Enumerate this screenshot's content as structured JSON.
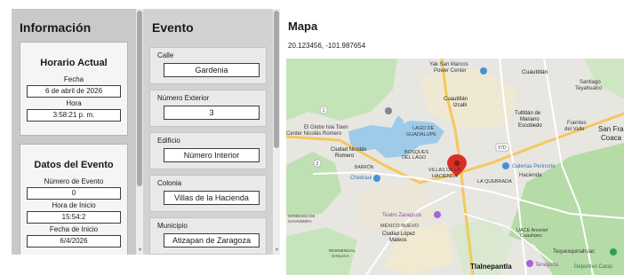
{
  "info": {
    "title": "Información",
    "horario": {
      "heading": "Horario Actual",
      "fecha_label": "Fecha",
      "fecha": "6 de abril de 2026",
      "hora_label": "Hora",
      "hora": "3:58:21 p. m."
    },
    "datos": {
      "heading": "Datos del Evento",
      "numero_label": "Número de Evento",
      "numero": "0",
      "hora_inicio_label": "Hora de Inicio",
      "hora_inicio": "15:54:2",
      "fecha_inicio_label": "Fecha de Inicio",
      "fecha_inicio": "6/4/2026"
    }
  },
  "evento": {
    "title": "Evento",
    "fields": [
      {
        "label": "Calle",
        "value": "Gardenia"
      },
      {
        "label": "Número Exterior",
        "value": "3"
      },
      {
        "label": "Edificio",
        "value": "Número Interior"
      },
      {
        "label": "Colonia",
        "value": "Villas de la Hacienda"
      },
      {
        "label": "Municipio",
        "value": "Atizapan de Zaragoza"
      }
    ]
  },
  "mapa": {
    "title": "Mapa",
    "coords": "20.123456, -101.987654",
    "places": {
      "yak_san_marcos": "Yak San Marcos",
      "power_center": "Power Center",
      "cuautitlan": "Cuautitlán",
      "santiago": "Santiago",
      "teyahualco": "Teyahualco",
      "cuautitlan_izcalli_1": "Cuautitlán",
      "cuautitlan_izcalli_2": "Izcalli",
      "tultitlan_1": "Tultitlán de",
      "tultitlan_2": "Mariano",
      "tultitlan_3": "Escobedo",
      "fuentes_1": "Fuentes",
      "fuentes_2": "del Valle",
      "san_fran_1": "San Fran",
      "san_fran_2": "Coaca",
      "globo_1": "El Globo Isla Town",
      "globo_2": "Center Nicolás Romero",
      "lago_1": "LAGO DE",
      "lago_2": "GUADALUPE",
      "ciudad_nicolas_1": "Ciudad Nicolás",
      "ciudad_nicolas_2": "Romero",
      "bosques_1": "BOSQUES",
      "bosques_2": "DEL LAGO",
      "galerias": "Galerías Perinorte",
      "barron": "BARRÓN",
      "chedraui": "Chedraui",
      "villas_1": "VILLAS DE LA",
      "villas_2": "HACIENDA",
      "hacienda": "Hacienda",
      "la_quebrada": "LA QUEBRADA",
      "teatro": "Teatro Zaragoza",
      "condado_1": "CONDADO DE",
      "condado_2": "SAYAVEDRA",
      "mexico_nuevo": "MÉXICO NUEVO",
      "lopez_1": "Ciudad López",
      "lopez_2": "Mateos",
      "uace_1": "UACE Annetel",
      "uace_2": "Cuauhpec",
      "tequexquinahuac": "Tequexquinahuac",
      "residencial_1": "RESIDENCIAL",
      "residencial_2": "CHILUCA",
      "tlalnepantla": "Tlalnepantla",
      "tenayuca": "Tenayuca",
      "deportivo": "Deportivo Carac",
      "road_57": "57D",
      "road_1": "1",
      "road_2": "2"
    }
  },
  "colors": {
    "info_bg": "#c9c9c9",
    "evento_bg": "#d2d2d2",
    "card_bg": "#f5f5f5",
    "field_bg": "#e9e9e9",
    "map_base": "#eef0ea",
    "map_green": "#b9dcae",
    "map_urban": "#e4e2dc",
    "map_water": "#a5cdea",
    "map_road": "#f6c95e",
    "pin": "#d93025"
  },
  "icons": {
    "pin": "map-pin-icon",
    "poi": "poi-icon"
  }
}
